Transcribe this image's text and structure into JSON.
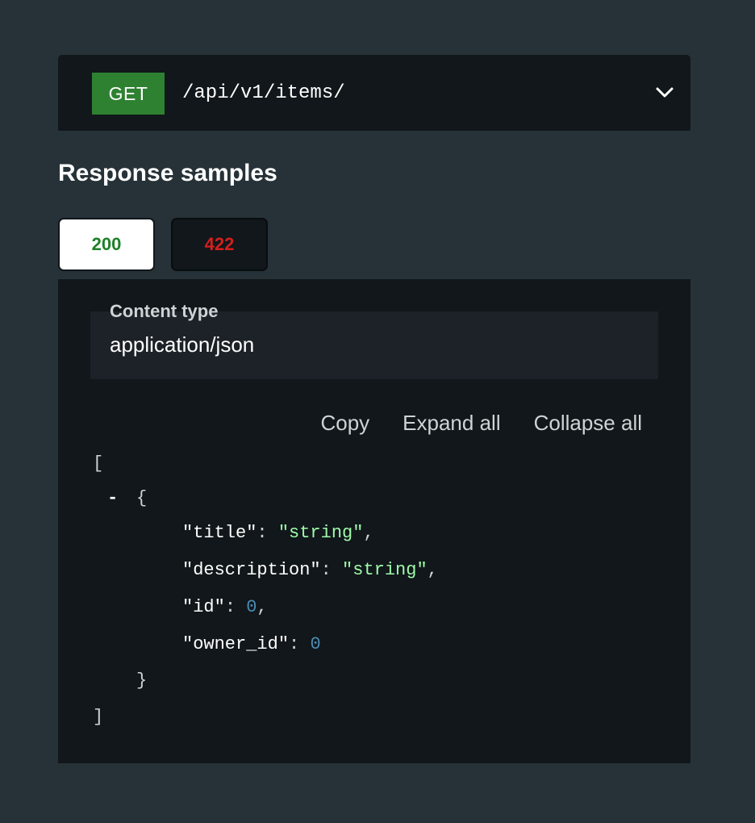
{
  "endpoint": {
    "method": "GET",
    "path": "/api/v1/items/",
    "method_color": "#2f8132",
    "expand_icon": "chevron-down-icon"
  },
  "response_samples": {
    "heading": "Response samples",
    "tabs": [
      {
        "label": "200",
        "color": "#1d8127",
        "selected": true
      },
      {
        "label": "422",
        "color": "#d41f1c",
        "selected": false
      }
    ],
    "content_type": {
      "label": "Content type",
      "value": "application/json"
    },
    "controls": {
      "copy": "Copy",
      "expand_all": "Expand all",
      "collapse_all": "Collapse all"
    },
    "code": {
      "open_bracket": "[",
      "collapse_toggle": "-",
      "open_brace": "{",
      "fields": [
        {
          "key": "\"title\"",
          "value": "\"string\"",
          "type": "string",
          "trailing": ","
        },
        {
          "key": "\"description\"",
          "value": "\"string\"",
          "type": "string",
          "trailing": ","
        },
        {
          "key": "\"id\"",
          "value": "0",
          "type": "number",
          "trailing": ","
        },
        {
          "key": "\"owner_id\"",
          "value": "0",
          "type": "number",
          "trailing": ""
        }
      ],
      "colon": ":",
      "close_brace": "}",
      "close_bracket": "]"
    }
  }
}
